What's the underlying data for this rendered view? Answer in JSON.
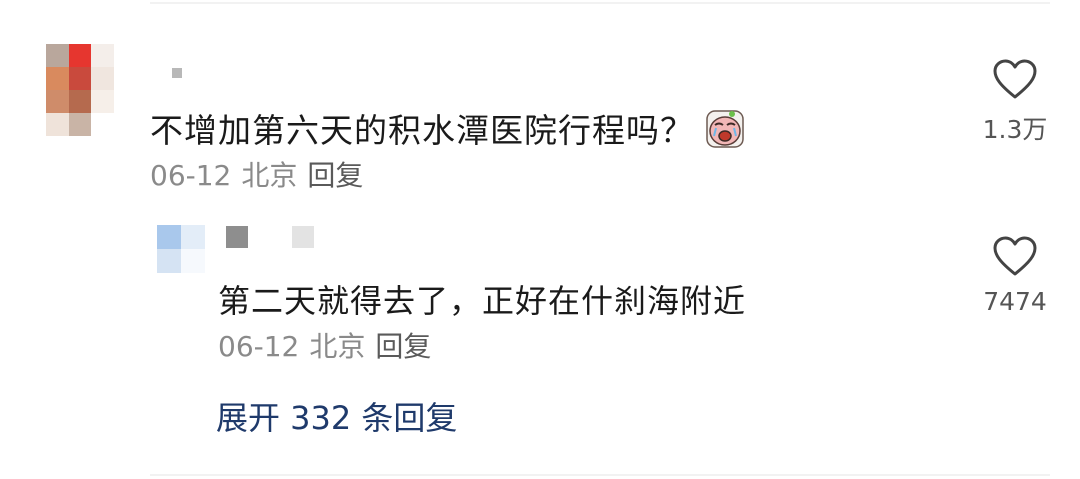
{
  "comment": {
    "text": "不增加第六天的积水潭医院行程吗？",
    "emoji": "crying-face-emoji",
    "date": "06-12",
    "location": "北京",
    "reply_label": "回复",
    "likes": "1.3万"
  },
  "reply": {
    "text": "第二天就得去了，正好在什刹海附近",
    "date": "06-12",
    "location": "北京",
    "reply_label": "回复",
    "likes": "7474"
  },
  "expand_replies": "展开 332 条回复",
  "colors": {
    "meta_text": "#8a8a8a",
    "expand_link": "#1f3a6b",
    "main_text": "#1a1a1a"
  }
}
